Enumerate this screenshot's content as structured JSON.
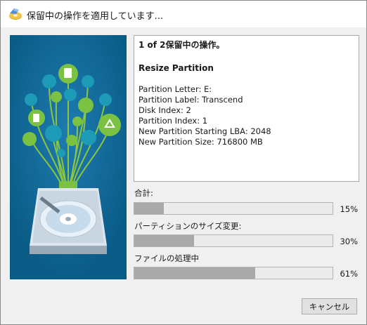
{
  "window": {
    "title": "保留中の操作を適用しています..."
  },
  "info": {
    "header": "1 of 2保留中の操作。",
    "operation": "Resize Partition",
    "details": [
      "Partition Letter: E:",
      "Partition Label: Transcend",
      "Disk Index: 2",
      "Partition Index: 1",
      "New Partition Starting LBA: 2048",
      "New Partition Size: 716800 MB"
    ]
  },
  "progress": [
    {
      "label": "合計:",
      "value": 15,
      "text": "15%"
    },
    {
      "label": "パーティションのサイズ変更:",
      "value": 30,
      "text": "30%"
    },
    {
      "label": "ファイルの処理中",
      "value": 61,
      "text": "61%"
    }
  ],
  "buttons": {
    "cancel": "キャンセル"
  },
  "colors": {
    "hero_bg": "#0a5c87",
    "accent_green": "#7cc242",
    "bar_fill": "#a9a9a9"
  },
  "icons": [
    "app-disk-icon",
    "document-icon",
    "recycle-icon",
    "pie-chart-icon",
    "hard-drive-icon"
  ]
}
